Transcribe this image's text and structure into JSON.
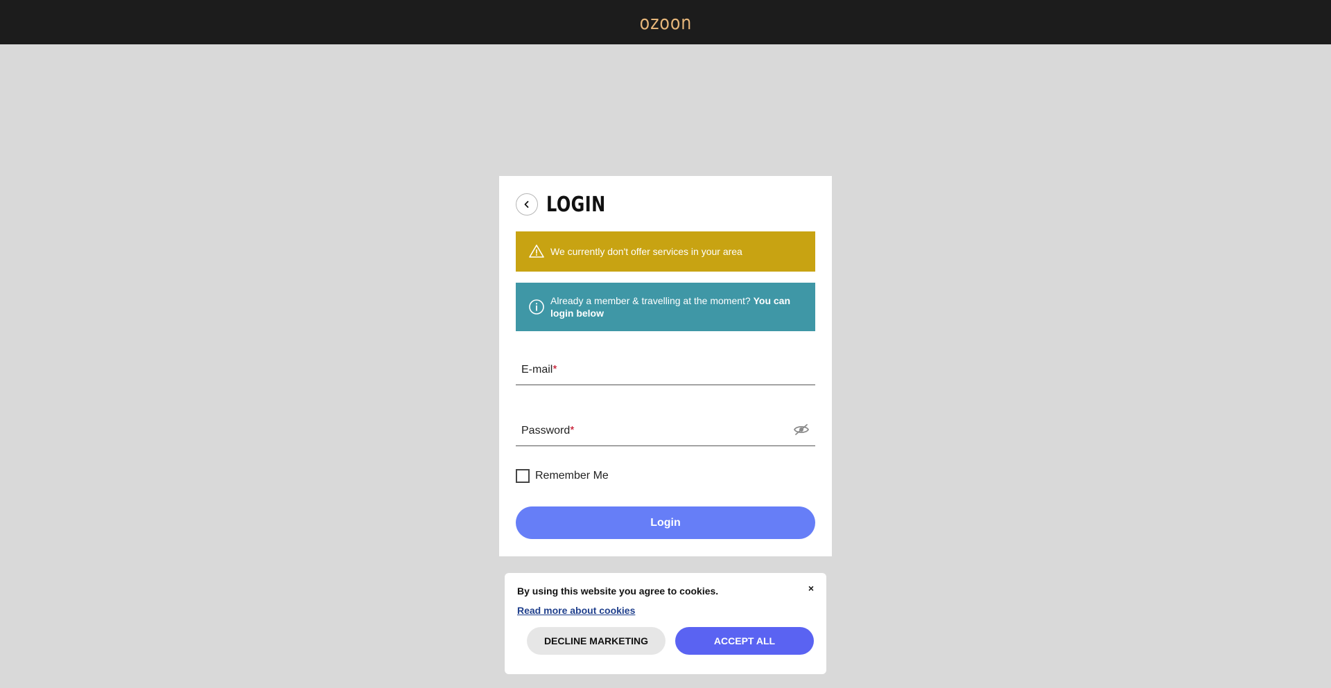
{
  "header": {
    "logo_text": "ozoon",
    "background": "#1c1c1c",
    "logo_color": "#e6b67a"
  },
  "login": {
    "back_icon": "chevron-left-icon",
    "title": "LOGIN",
    "warning": {
      "icon": "warning-triangle-icon",
      "text": "We currently don't offer services in your area",
      "color": "#c8a312"
    },
    "info": {
      "icon": "info-circle-icon",
      "text": "Already a member & travelling at the moment?",
      "bold_text": "You can login below",
      "color": "#3f97a6"
    },
    "email": {
      "label": "E-mail",
      "required_mark": "*",
      "value": ""
    },
    "password": {
      "label": "Password",
      "required_mark": "*",
      "value": "",
      "toggle_icon": "eye-slash-icon"
    },
    "remember": {
      "label": "Remember Me",
      "checked": false
    },
    "submit_label": "Login",
    "submit_color": "#667ef7"
  },
  "cookie_banner": {
    "message": "By using this website you agree to cookies.",
    "link_text": "Read more about cookies",
    "close_label": "×",
    "decline_label": "DECLINE MARKETING",
    "accept_label": "ACCEPT ALL",
    "accept_color": "#5a63f2"
  }
}
